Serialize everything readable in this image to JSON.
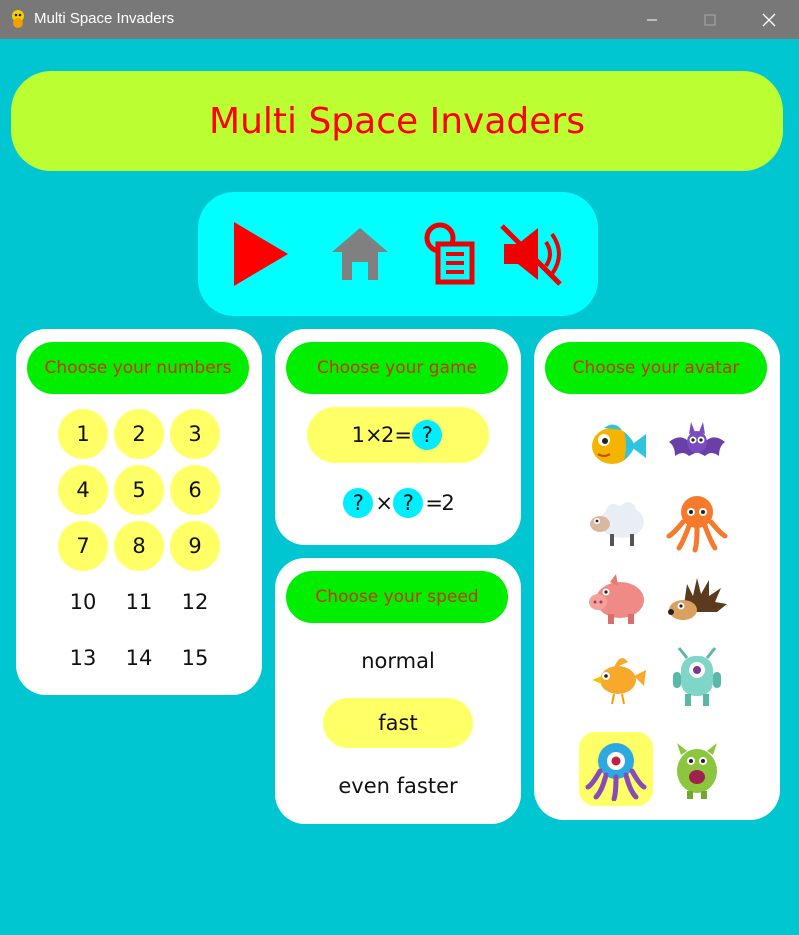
{
  "window": {
    "title": "Multi Space Invaders",
    "icon": "python-snake-icon",
    "controls": [
      "minimize-icon",
      "maximize-icon",
      "close-icon"
    ]
  },
  "banner": {
    "title": "Multi Space Invaders"
  },
  "toolbar": {
    "icons": [
      "play-icon",
      "home-icon",
      "scoreboard-icon",
      "sound-muted-icon"
    ]
  },
  "numbers_panel": {
    "heading": "Choose your numbers",
    "items": [
      {
        "label": "1",
        "selected": true
      },
      {
        "label": "2",
        "selected": true
      },
      {
        "label": "3",
        "selected": true
      },
      {
        "label": "4",
        "selected": true
      },
      {
        "label": "5",
        "selected": true
      },
      {
        "label": "6",
        "selected": true
      },
      {
        "label": "7",
        "selected": true
      },
      {
        "label": "8",
        "selected": true
      },
      {
        "label": "9",
        "selected": true
      },
      {
        "label": "10",
        "selected": false
      },
      {
        "label": "11",
        "selected": false
      },
      {
        "label": "12",
        "selected": false
      },
      {
        "label": "13",
        "selected": false
      },
      {
        "label": "14",
        "selected": false
      },
      {
        "label": "15",
        "selected": false
      }
    ]
  },
  "game_panel": {
    "heading": "Choose your game",
    "option1": {
      "a": "1",
      "op": "×",
      "b": "2",
      "eq": "=",
      "result": "?",
      "selected": true
    },
    "option2": {
      "a": "?",
      "op": "×",
      "b": "?",
      "eq": "=",
      "result": "2",
      "selected": false
    }
  },
  "speed_panel": {
    "heading": "Choose your speed",
    "options": [
      {
        "label": "normal",
        "selected": false
      },
      {
        "label": "fast",
        "selected": true
      },
      {
        "label": "even faster",
        "selected": false
      }
    ]
  },
  "avatar_panel": {
    "heading": "Choose your avatar",
    "avatars": [
      "fish-avatar-icon",
      "bat-avatar-icon",
      "sheep-avatar-icon",
      "octopus-avatar-icon",
      "pig-avatar-icon",
      "hedgehog-avatar-icon",
      "bird-avatar-icon",
      "cyclops-monster-avatar-icon",
      "blue-octopus-monster-avatar-icon",
      "green-monster-avatar-icon"
    ],
    "selected_index": 8
  },
  "colors": {
    "background": "#00c6d2",
    "banner": "#bbff33",
    "toolbar": "#00ffff",
    "heading_bg": "#00ee00",
    "heading_text": "#cc3300",
    "selected": "#ffff66",
    "accent_red": "#ff0000"
  }
}
